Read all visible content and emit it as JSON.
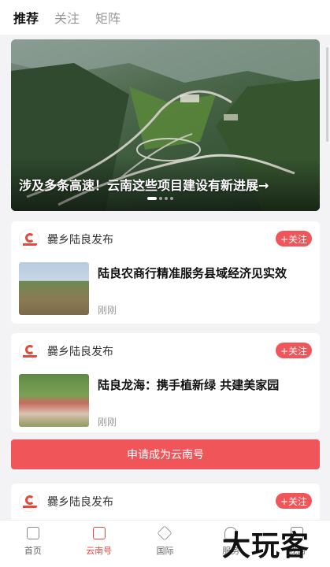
{
  "tabs": [
    "推荐",
    "关注",
    "矩阵"
  ],
  "hero": {
    "title": "涉及多条高速！云南这些项目建设有新进展→",
    "dots": 4,
    "active_dot": 0
  },
  "cards": [
    {
      "source": "爨乡陆良发布",
      "follow": "+关注",
      "title": "陆良农商行精准服务县域经济见实效",
      "time": "刚刚"
    },
    {
      "source": "爨乡陆良发布",
      "follow": "+关注",
      "title": "陆良龙海：携手植新绿 共建美家园",
      "time": "刚刚"
    },
    {
      "source": "爨乡陆良发布",
      "follow": "+关注"
    }
  ],
  "apply_button": "申请成为云南号",
  "bottom_nav": [
    {
      "label": "首页",
      "icon": "home-icon"
    },
    {
      "label": "云南号",
      "icon": "phone-icon",
      "active": true
    },
    {
      "label": "国际",
      "icon": "diamond-icon"
    },
    {
      "label": "服务",
      "icon": "heart-icon"
    },
    {
      "label": "我的",
      "icon": "user-icon"
    }
  ],
  "watermark": "大玩客",
  "colors": {
    "accent": "#f0555a",
    "active_nav": "#e8473f"
  }
}
